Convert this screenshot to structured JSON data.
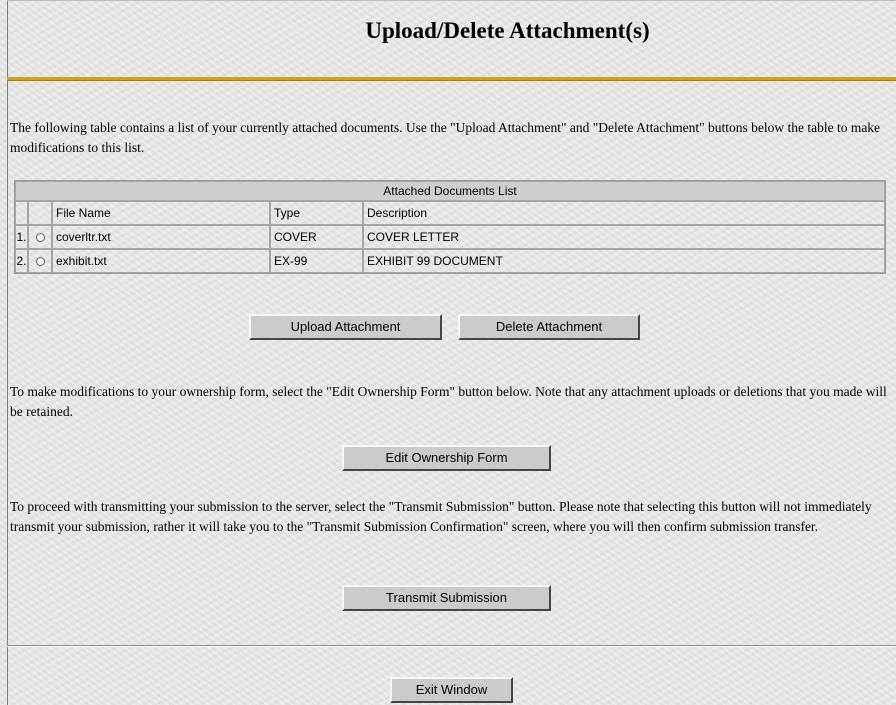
{
  "page": {
    "title": "Upload/Delete Attachment(s)"
  },
  "intro_text": "The following table contains a list of your currently attached documents. Use the \"Upload Attachment\" and \"Delete Attachment\" buttons below the table to make modifications to this list.",
  "attachments_table": {
    "caption": "Attached Documents List",
    "headers": [
      "",
      "",
      "File Name",
      "Type",
      "Description"
    ],
    "rows": [
      {
        "num": "1.",
        "file_name": "coverltr.txt",
        "type": "COVER",
        "description": "COVER LETTER"
      },
      {
        "num": "2.",
        "file_name": "exhibit.txt",
        "type": "EX-99",
        "description": "EXHIBIT 99 DOCUMENT"
      }
    ]
  },
  "buttons": {
    "upload": "Upload Attachment",
    "delete": "Delete Attachment",
    "edit": "Edit Ownership Form",
    "transmit": "Transmit Submission",
    "exit": "Exit Window"
  },
  "edit_text": "To make modifications to your ownership form, select the \"Edit Ownership Form\" button below. Note that any attachment uploads or deletions that you made will be retained.",
  "transmit_text": "To proceed with transmitting your submission to the server, select the \"Transmit Submission\" button. Please note that selecting this button will not immediately transmit your submission, rather it will take you to the \"Transmit Submission Confirmation\" screen, where you will then confirm submission transfer.",
  "colors": {
    "accent_rule": "#d4a020",
    "button_face": "#cbcbcb",
    "table_caption_bg": "#cfcfcf"
  }
}
